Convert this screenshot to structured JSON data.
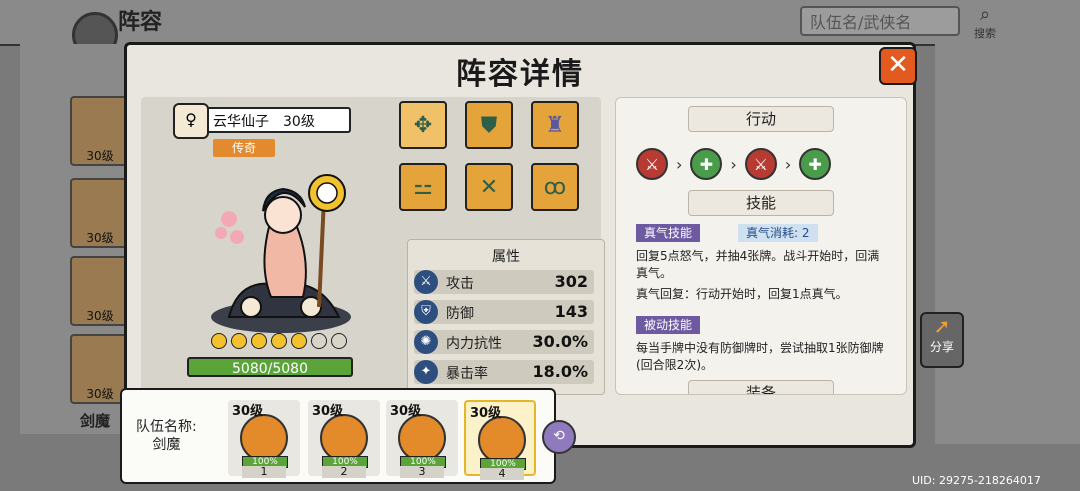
{
  "background": {
    "page_title": "阵容",
    "search_placeholder": "队伍名/武侠名",
    "search_button": "搜索",
    "roster_levels": [
      "30级",
      "30级",
      "30级",
      "30级"
    ],
    "team_name_short": "剑魔",
    "share_label": "分享",
    "uid": "UID: 29275-218264017"
  },
  "modal": {
    "title": "阵容详情",
    "close_label": "✕",
    "hero": {
      "name_level": "云华仙子　30级",
      "gender_icon": "♀",
      "rarity": "传奇",
      "stars_filled": 5,
      "stars_total": 7,
      "hp_text": "5080/5080"
    },
    "equipment_icons": [
      "medallion-icon",
      "armor-icon",
      "robe-icon",
      "boots-icon",
      "bracers-icon",
      "earrings-icon"
    ],
    "attributes": {
      "title": "属性",
      "rows": [
        {
          "icon": "sword-icon",
          "glyph": "⚔",
          "label": "攻击",
          "value": "302"
        },
        {
          "icon": "shield-icon",
          "glyph": "⛨",
          "label": "防御",
          "value": "143"
        },
        {
          "icon": "swirl-icon",
          "glyph": "✺",
          "label": "内力抗性",
          "value": "30.0%"
        },
        {
          "icon": "crit-icon",
          "glyph": "✦",
          "label": "暴击率",
          "value": "18.0%"
        }
      ]
    },
    "actions": {
      "title": "行动",
      "sequence": [
        "attack",
        "heal",
        "attack",
        "heal"
      ]
    },
    "skills": {
      "title": "技能",
      "qi_tag": "真气技能",
      "qi_cost": "真气消耗: 2",
      "qi_desc": "回复5点怒气，并抽4张牌。战斗开始时，回满真气。",
      "qi_regen": "真气回复：行动开始时，回复1点真气。",
      "passive_tag": "被动技能",
      "passive_desc": "每当手牌中没有防御牌时，尝试抽取1张防御牌(回合限2次)。",
      "next_section": "装备"
    }
  },
  "team": {
    "label_line1": "队伍名称:",
    "label_line2": "剑魔",
    "members": [
      {
        "level": "30级",
        "hp": "100%",
        "slot": "1"
      },
      {
        "level": "30级",
        "hp": "100%",
        "slot": "2"
      },
      {
        "level": "30级",
        "hp": "100%",
        "slot": "3"
      },
      {
        "level": "30级",
        "hp": "100%",
        "slot": "4"
      }
    ]
  },
  "colors": {
    "accent_orange": "#e48a2e",
    "close_red": "#e25a1f",
    "hp_green": "#5aa43a",
    "skill_purple": "#6d5aa0"
  }
}
